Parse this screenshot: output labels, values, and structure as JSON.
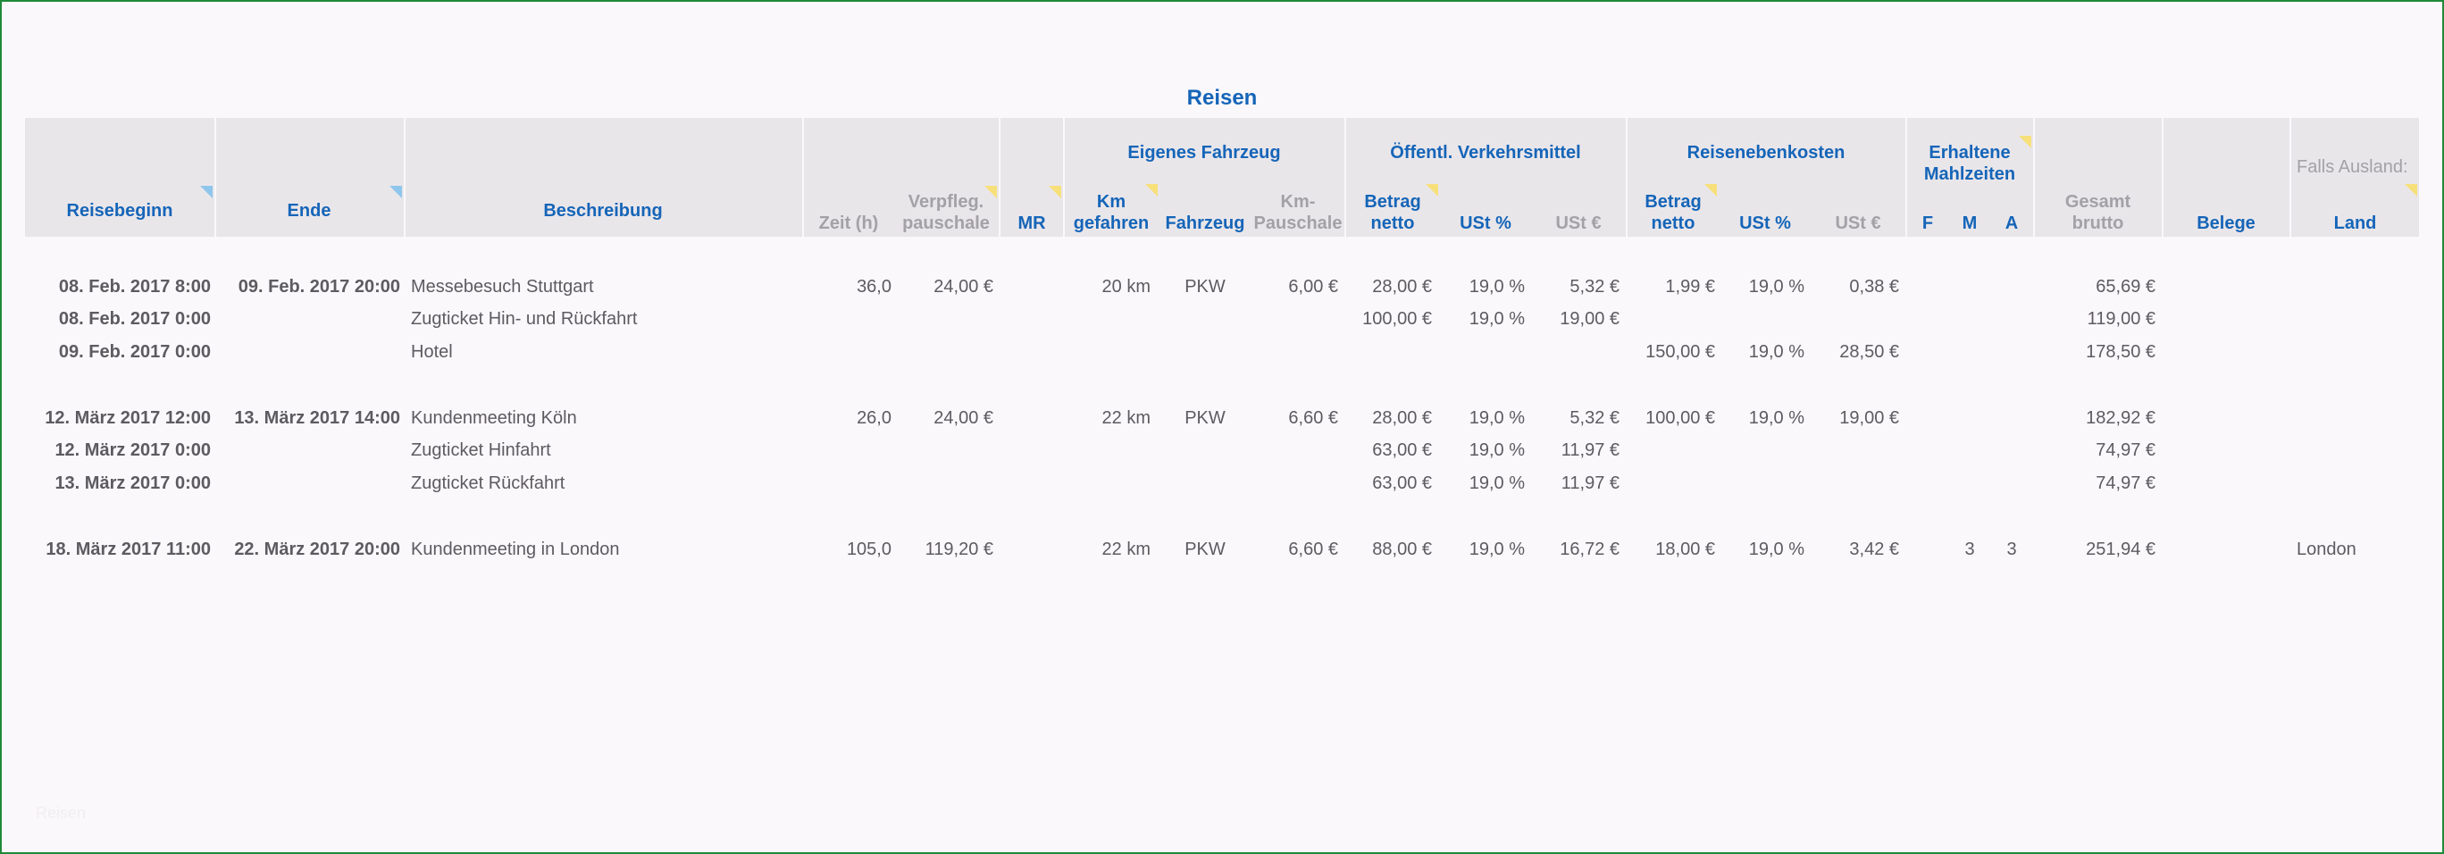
{
  "title": "Reisen",
  "header": {
    "reisebeginn": "Reisebeginn",
    "ende": "Ende",
    "beschreibung": "Beschreibung",
    "zeit": "Zeit (h)",
    "verpfleg_1": "Verpfleg.",
    "verpfleg_2": "pauschale",
    "mr": "MR",
    "eigenes_fahrzeug": "Eigenes Fahrzeug",
    "km_1": "Km",
    "km_2": "gefahren",
    "fahrzeug": "Fahrzeug",
    "kmp_1": "Km-",
    "kmp_2": "Pauschale",
    "oeffentl": "Öffentl. Verkehrsmittel",
    "betrag_1": "Betrag",
    "betrag_2": "netto",
    "ust_pct": "USt %",
    "ust_eur": "USt €",
    "reisenebenkosten": "Reisenebenkosten",
    "erhaltene_1": "Erhaltene",
    "erhaltene_2": "Mahlzeiten",
    "f": "F",
    "m": "M",
    "a": "A",
    "gesamt_1": "Gesamt",
    "gesamt_2": "brutto",
    "belege": "Belege",
    "falls_ausland": "Falls Ausland:",
    "land": "Land"
  },
  "rows": [
    {
      "start": "08. Feb. 2017  8:00",
      "end": "09. Feb. 2017  20:00",
      "desc": "Messebesuch Stuttgart",
      "zeit": "36,0",
      "verpfl": "24,00 €",
      "km": "20 km",
      "fahrzeug": "PKW",
      "kmp": "6,00 €",
      "oev_betrag": "28,00 €",
      "oev_ust_pct": "19,0 %",
      "oev_ust": "5,32 €",
      "rnk_betrag": "1,99 €",
      "rnk_ust_pct": "19,0 %",
      "rnk_ust": "0,38 €",
      "f": "",
      "m": "",
      "a": "",
      "gesamt": "65,69 €",
      "land": ""
    },
    {
      "start": "08. Feb. 2017  0:00",
      "end": "",
      "desc": "Zugticket Hin- und Rückfahrt",
      "zeit": "",
      "verpfl": "",
      "km": "",
      "fahrzeug": "",
      "kmp": "",
      "oev_betrag": "100,00 €",
      "oev_ust_pct": "19,0 %",
      "oev_ust": "19,00 €",
      "rnk_betrag": "",
      "rnk_ust_pct": "",
      "rnk_ust": "",
      "f": "",
      "m": "",
      "a": "",
      "gesamt": "119,00 €",
      "land": ""
    },
    {
      "start": "09. Feb. 2017  0:00",
      "end": "",
      "desc": "Hotel",
      "zeit": "",
      "verpfl": "",
      "km": "",
      "fahrzeug": "",
      "kmp": "",
      "oev_betrag": "",
      "oev_ust_pct": "",
      "oev_ust": "",
      "rnk_betrag": "150,00 €",
      "rnk_ust_pct": "19,0 %",
      "rnk_ust": "28,50 €",
      "f": "",
      "m": "",
      "a": "",
      "gesamt": "178,50 €",
      "land": ""
    },
    {
      "start": "12. März 2017  12:00",
      "end": "13. März 2017  14:00",
      "desc": "Kundenmeeting Köln",
      "zeit": "26,0",
      "verpfl": "24,00 €",
      "km": "22 km",
      "fahrzeug": "PKW",
      "kmp": "6,60 €",
      "oev_betrag": "28,00 €",
      "oev_ust_pct": "19,0 %",
      "oev_ust": "5,32 €",
      "rnk_betrag": "100,00 €",
      "rnk_ust_pct": "19,0 %",
      "rnk_ust": "19,00 €",
      "f": "",
      "m": "",
      "a": "",
      "gesamt": "182,92 €",
      "land": ""
    },
    {
      "start": "12. März 2017  0:00",
      "end": "",
      "desc": "Zugticket Hinfahrt",
      "zeit": "",
      "verpfl": "",
      "km": "",
      "fahrzeug": "",
      "kmp": "",
      "oev_betrag": "63,00 €",
      "oev_ust_pct": "19,0 %",
      "oev_ust": "11,97 €",
      "rnk_betrag": "",
      "rnk_ust_pct": "",
      "rnk_ust": "",
      "f": "",
      "m": "",
      "a": "",
      "gesamt": "74,97 €",
      "land": ""
    },
    {
      "start": "13. März 2017  0:00",
      "end": "",
      "desc": "Zugticket Rückfahrt",
      "zeit": "",
      "verpfl": "",
      "km": "",
      "fahrzeug": "",
      "kmp": "",
      "oev_betrag": "63,00 €",
      "oev_ust_pct": "19,0 %",
      "oev_ust": "11,97 €",
      "rnk_betrag": "",
      "rnk_ust_pct": "",
      "rnk_ust": "",
      "f": "",
      "m": "",
      "a": "",
      "gesamt": "74,97 €",
      "land": ""
    },
    {
      "start": "18. März 2017  11:00",
      "end": "22. März 2017  20:00",
      "desc": "Kundenmeeting in London",
      "zeit": "105,0",
      "verpfl": "119,20 €",
      "km": "22 km",
      "fahrzeug": "PKW",
      "kmp": "6,60 €",
      "oev_betrag": "88,00 €",
      "oev_ust_pct": "19,0 %",
      "oev_ust": "16,72 €",
      "rnk_betrag": "18,00 €",
      "rnk_ust_pct": "19,0 %",
      "rnk_ust": "3,42 €",
      "f": "",
      "m": "3",
      "a": "3",
      "gesamt": "251,94 €",
      "land": "London"
    }
  ],
  "footnote": "Reisen"
}
